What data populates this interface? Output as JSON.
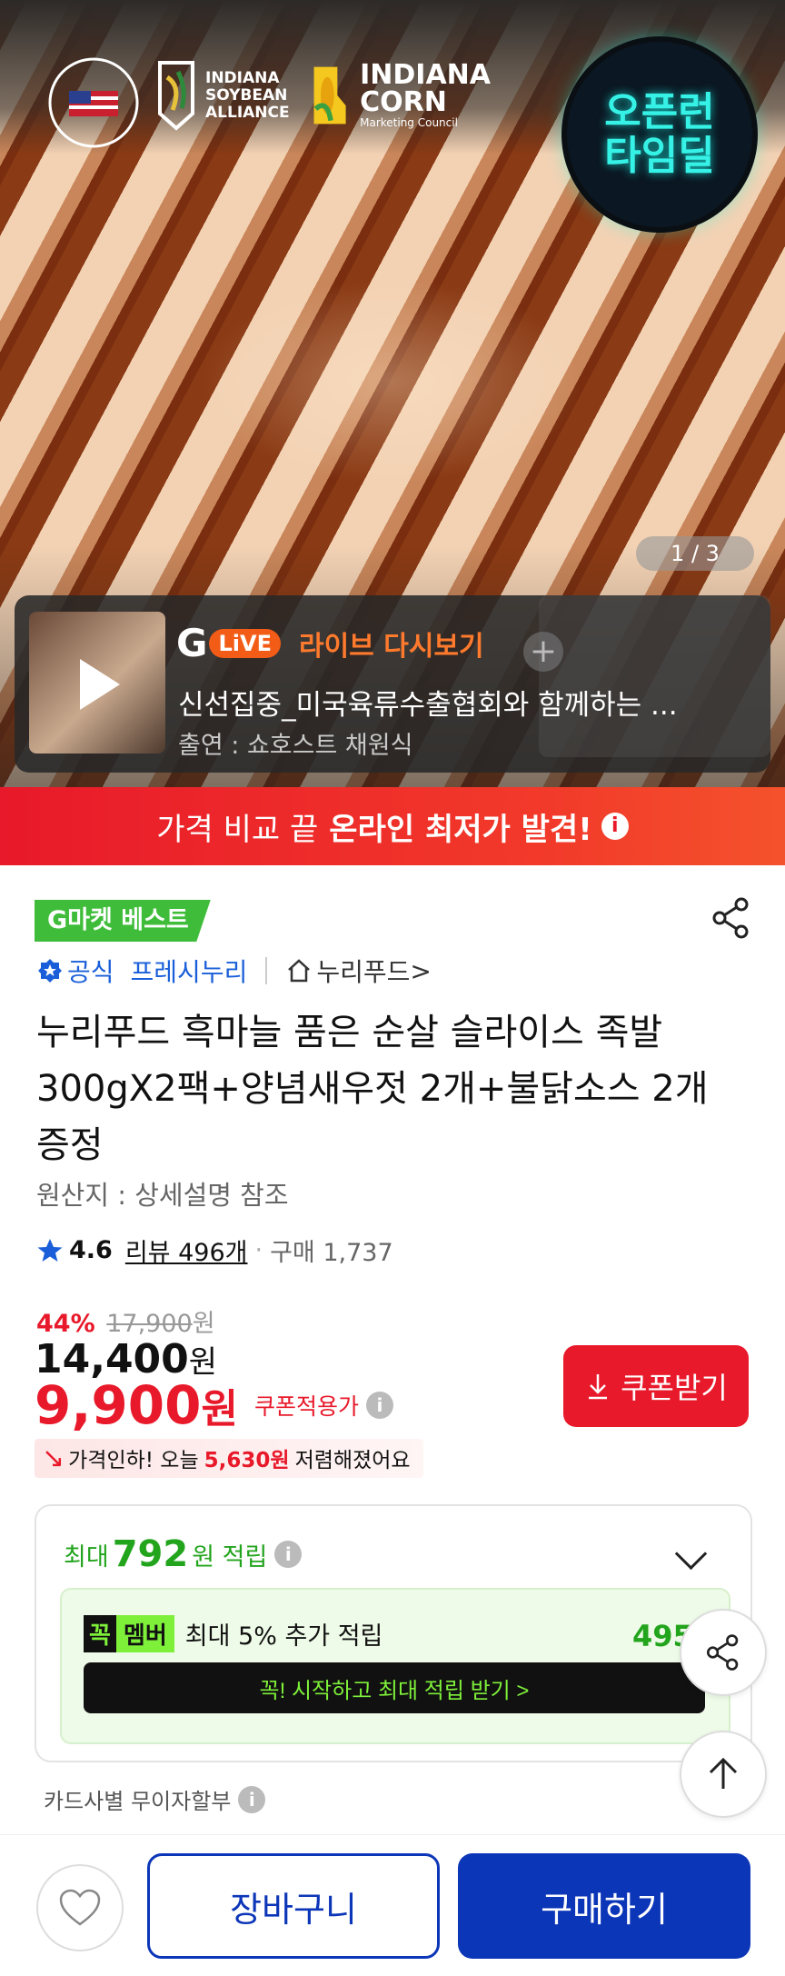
{
  "hero": {
    "logos": {
      "usmeat": "U.S. MEAT EXPORT FEDERATION",
      "soy_line1": "INDIANA",
      "soy_line2": "SOYBEAN",
      "soy_line3": "ALLIANCE",
      "corn_line1": "INDIANA",
      "corn_line2": "CORN",
      "corn_line3": "Marketing Council"
    },
    "badge_line1": "오픈런",
    "badge_line2": "타임딜",
    "page_indicator": "1 / 3"
  },
  "live": {
    "g_letter": "G",
    "live_label": "LiVE",
    "replay_label": "라이브 다시보기",
    "title": "신선집중_미국육류수출협회와 함께하는 ...",
    "host": "출연 : 쇼호스트 채원식"
  },
  "banner": {
    "prefix": "가격 비교 끝",
    "highlight": "온라인 최저가 발견!",
    "info_glyph": "i"
  },
  "product": {
    "badge": "G마켓 베스트",
    "official": "공식",
    "brand_tag": "프레시누리",
    "store": "누리푸드",
    "store_arrow": ">",
    "title": "누리푸드 흑마늘 품은 순살 슬라이스 족발 300gX2팩+양념새우젓 2개+불닭소스 2개 증정",
    "origin": "원산지 : 상세설명 참조",
    "rating": "4.6",
    "review": "리뷰 496개",
    "dot": "·",
    "purchases": "구매 1,737"
  },
  "price": {
    "discount_pct": "44%",
    "list_price": "17,900",
    "list_unit": "원",
    "sale_price": "14,400",
    "sale_unit": "원",
    "coupon_price": "9,900",
    "coupon_unit": "원",
    "coupon_label": "쿠폰적용가",
    "q_glyph": "i",
    "coupon_button": "쿠폰받기",
    "drop_prefix": "가격인하! 오늘",
    "drop_amount": "5,630원",
    "drop_suffix": "저렴해졌어요"
  },
  "points": {
    "prefix": "최대",
    "amount": "792",
    "suffix": "원 적립",
    "q_glyph": "i",
    "member_kkok": "꼭",
    "member_label": "멤버",
    "member_text": "최대 5% 추가 적립",
    "member_points": "495원",
    "start_button": "꼭! 시작하고 최대 적립 받기  >"
  },
  "installment": {
    "label": "카드사별 무이자할부",
    "q_glyph": "i"
  },
  "bottom": {
    "cart": "장바구니",
    "buy": "구매하기"
  },
  "colors": {
    "accent_red": "#e8192a",
    "brand_blue": "#0c36b8",
    "point_green": "#23a41d"
  }
}
